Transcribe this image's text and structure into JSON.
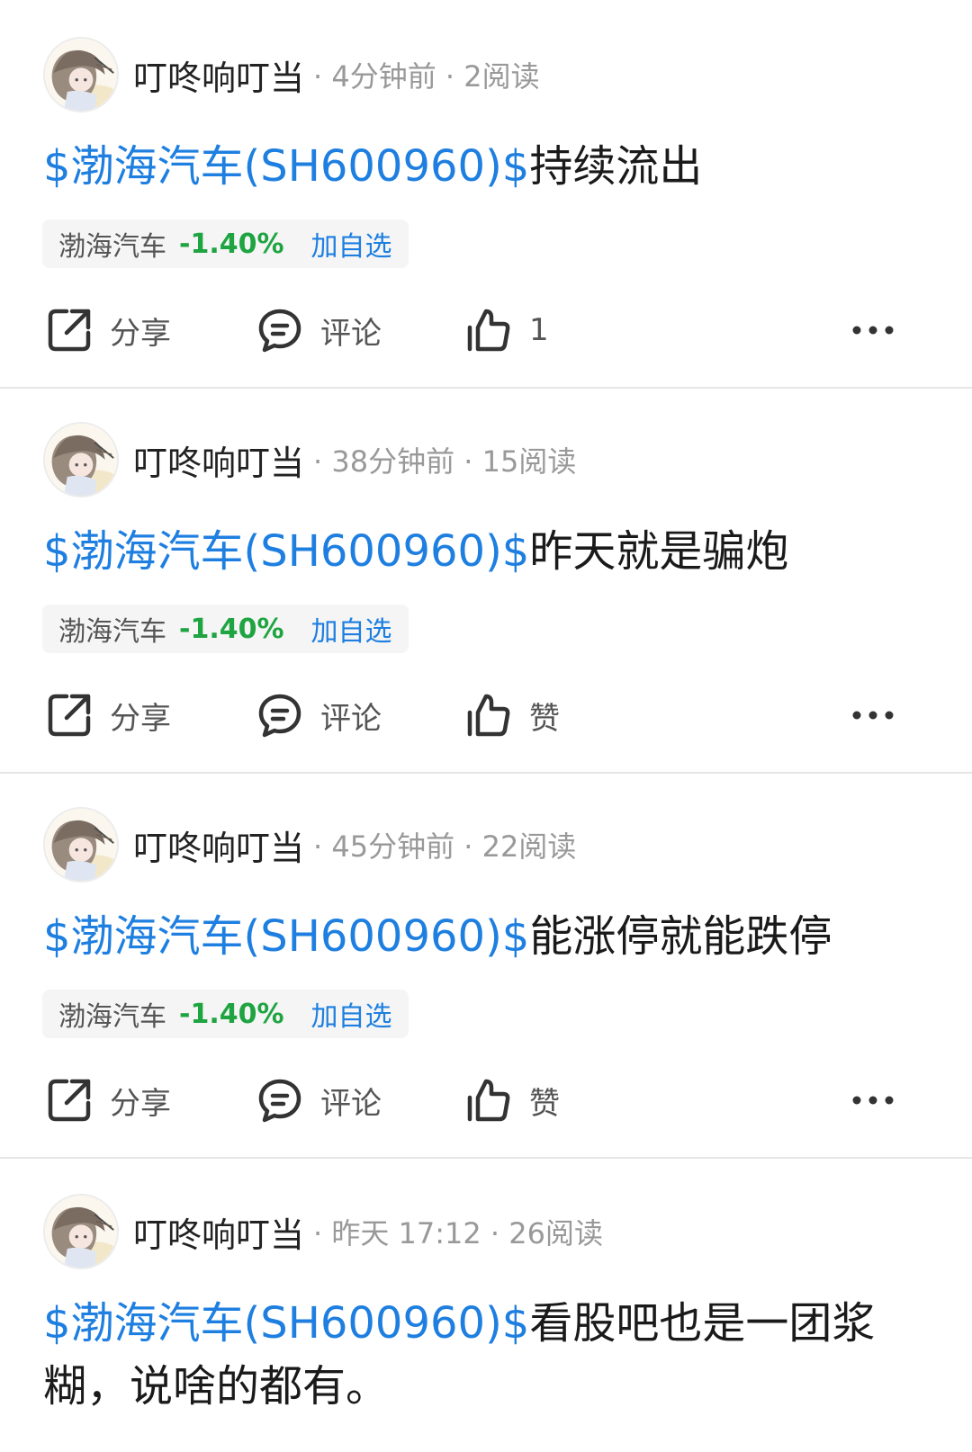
{
  "icons": {
    "share": "share-icon",
    "comment": "comment-icon",
    "like": "like-icon",
    "more": "more-icon"
  },
  "colors": {
    "link": "#1e7fe0",
    "down": "#1fa442",
    "meta": "#999999"
  },
  "posts": [
    {
      "author": "叮咚响叮当",
      "meta": "· 4分钟前 · 2阅读",
      "stock_tag": "$渤海汽车(SH600960)$",
      "text": "持续流出",
      "pill": {
        "name": "渤海汽车",
        "change": "-1.40%",
        "add": "加自选"
      },
      "actions": {
        "share": "分享",
        "comment": "评论",
        "like": "1"
      }
    },
    {
      "author": "叮咚响叮当",
      "meta": "· 38分钟前 · 15阅读",
      "stock_tag": "$渤海汽车(SH600960)$",
      "text": "昨天就是骗炮",
      "pill": {
        "name": "渤海汽车",
        "change": "-1.40%",
        "add": "加自选"
      },
      "actions": {
        "share": "分享",
        "comment": "评论",
        "like": "赞"
      }
    },
    {
      "author": "叮咚响叮当",
      "meta": "· 45分钟前 · 22阅读",
      "stock_tag": "$渤海汽车(SH600960)$",
      "text": "能涨停就能跌停",
      "pill": {
        "name": "渤海汽车",
        "change": "-1.40%",
        "add": "加自选"
      },
      "actions": {
        "share": "分享",
        "comment": "评论",
        "like": "赞"
      }
    },
    {
      "author": "叮咚响叮当",
      "meta": "· 昨天 17:12 · 26阅读",
      "stock_tag": "$渤海汽车(SH600960)$",
      "text": "看股吧也是一团浆糊，说啥的都有。"
    }
  ]
}
